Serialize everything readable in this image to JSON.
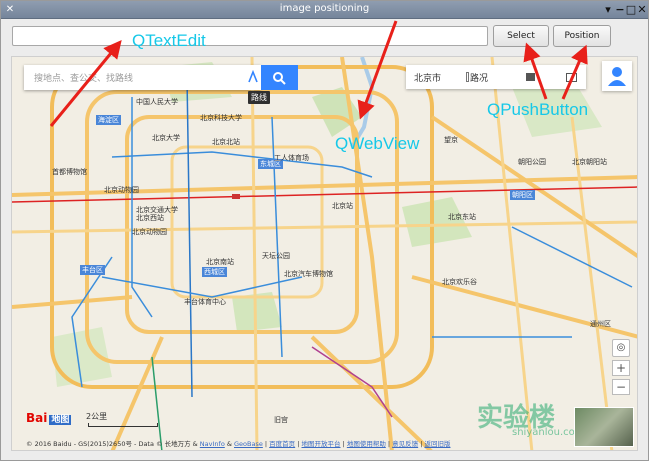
{
  "window": {
    "title": "image positioning"
  },
  "toolbar": {
    "text_edit_value": "",
    "select_label": "Select",
    "position_label": "Position"
  },
  "map": {
    "search_placeholder": "搜地点、查公交、找路线",
    "tooltip": "路线",
    "city": "北京市",
    "traffic": "路况",
    "zoom_in": "+",
    "zoom_out": "−",
    "scale": "2公里",
    "logo_text": "Bai",
    "logo_map": "地图",
    "copyright_prefix": "© 2016 Baidu - GS(2015)2650号 - Data © 长地万方 & ",
    "copyright_links": [
      "NavInfo",
      "GeoBase",
      "百度首页",
      "地图开放平台",
      "地图使用帮助",
      "意见反馈",
      "返回旧版"
    ],
    "labels": [
      "海淀区",
      "中国人民大学",
      "北京大学",
      "北京科技大学",
      "北京交通大学",
      "北京动物园",
      "西城区",
      "东城区",
      "朝阳区",
      "北京北站",
      "北京站",
      "丰台区",
      "北京南站",
      "北京西站",
      "天坛公园",
      "北京东站",
      "望京",
      "北京朝阳站",
      "工人体育场",
      "首都博物馆",
      "朝阳公园",
      "通州区",
      "北京欢乐谷",
      "丰台体育中心",
      "北京汽车博物馆",
      "北京动物园",
      "旧宫"
    ],
    "watermark": "实验楼",
    "watermark_sub": "shiyanlou.com"
  },
  "annotations": {
    "text_edit": "QTextEdit",
    "web_view": "QWebView",
    "push_button": "QPushButton"
  },
  "colors": {
    "annotation": "#16c8e8",
    "arrow": "#e8201a",
    "search_button": "#3385ff",
    "titlebar": "#8595aa"
  }
}
